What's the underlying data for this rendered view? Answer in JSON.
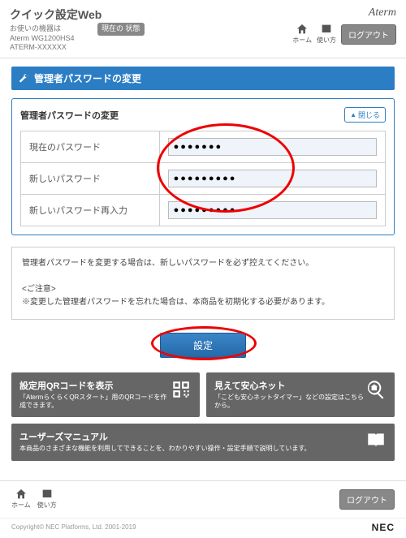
{
  "header": {
    "title": "クイック設定Web",
    "sub1": "お使いの機器は",
    "sub2": "Aterm WG1200HS4",
    "sub3": "ATERM-XXXXXX",
    "status": "現在の\n状態",
    "brand": "Aterm",
    "home": "ホーム",
    "usage": "使い方",
    "logout": "ログアウト"
  },
  "section": {
    "title": "管理者パスワードの変更"
  },
  "panel": {
    "title": "管理者パスワードの変更",
    "close": "閉じる",
    "row1": "現在のパスワード",
    "row2": "新しいパスワード",
    "row3": "新しいパスワード再入力",
    "val1": "●●●●●●●",
    "val2": "●●●●●●●●●",
    "val3": "●●●●●●●●●"
  },
  "note": {
    "line1": "管理者パスワードを変更する場合は、新しいパスワードを必ず控えてください。",
    "line2a": "<ご注意>",
    "line2b": "※変更した管理者パスワードを忘れた場合は、本商品を初期化する必要があります。"
  },
  "buttons": {
    "set": "設定"
  },
  "cards": {
    "qr_title": "設定用QRコードを表示",
    "qr_desc": "「AtermらくらくQRスタート」用のQRコードを作成できます。",
    "anshin_title": "見えて安心ネット",
    "anshin_desc": "「こども安心ネットタイマー」などの設定はこちらから。",
    "manual_title": "ユーザーズマニュアル",
    "manual_desc": "本商品のさまざまな機能を利用してできることを、わかりやすい操作・設定手順で説明しています。"
  },
  "footer": {
    "copyright": "Copyright© NEC Platforms, Ltd. 2001-2019",
    "nec": "NEC"
  }
}
